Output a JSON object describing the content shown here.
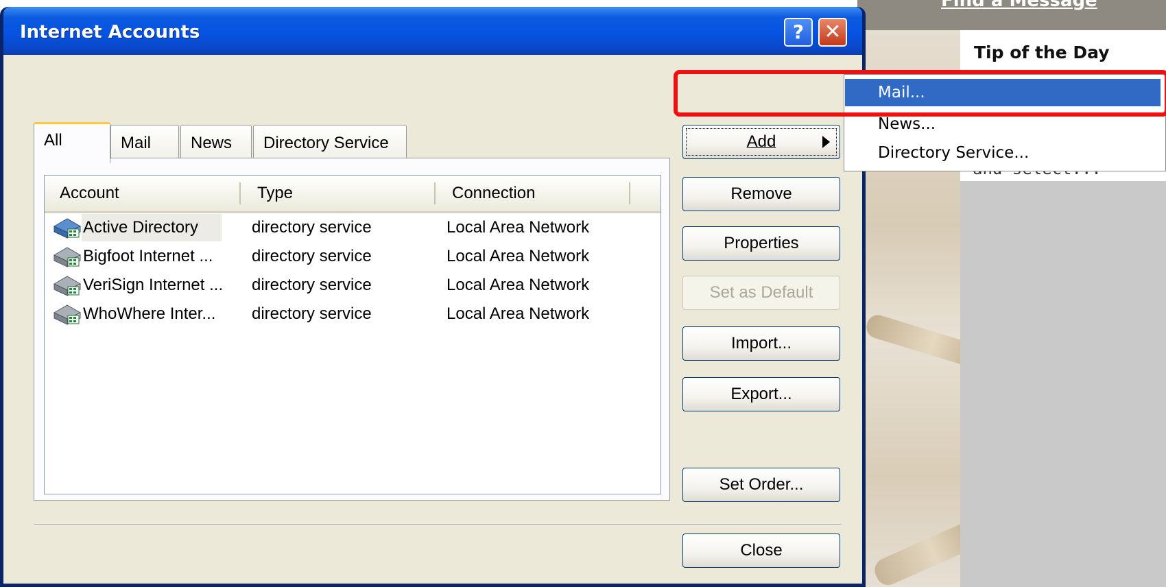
{
  "background": {
    "link_text": "Find a Message",
    "tip_title": "Tip of the Day",
    "tip_text": "and select..."
  },
  "dialog": {
    "title": "Internet Accounts",
    "help_label": "?",
    "close_label": "✕"
  },
  "tabs": [
    {
      "label": "All",
      "active": true
    },
    {
      "label": "Mail",
      "active": false
    },
    {
      "label": "News",
      "active": false
    },
    {
      "label": "Directory Service",
      "active": false
    }
  ],
  "list": {
    "columns": [
      "Account",
      "Type",
      "Connection"
    ],
    "rows": [
      {
        "account": "Active Directory",
        "type": "directory service",
        "connection": "Local Area Network"
      },
      {
        "account": "Bigfoot Internet ...",
        "type": "directory service",
        "connection": "Local Area Network"
      },
      {
        "account": "VeriSign Internet ...",
        "type": "directory service",
        "connection": "Local Area Network"
      },
      {
        "account": "WhoWhere Inter...",
        "type": "directory service",
        "connection": "Local Area Network"
      }
    ]
  },
  "buttons": {
    "add": "Add",
    "remove": "Remove",
    "properties": "Properties",
    "set_default": "Set as Default",
    "import": "Import...",
    "export": "Export...",
    "set_order": "Set Order...",
    "close": "Close"
  },
  "add_menu": {
    "items": [
      "Mail...",
      "News...",
      "Directory Service..."
    ],
    "selected_index": 0
  },
  "colors": {
    "titlebar": "#0553e2",
    "menu_highlight": "#316ac5",
    "annotation": "#ee1111",
    "dialog_face": "#ece9d8"
  }
}
